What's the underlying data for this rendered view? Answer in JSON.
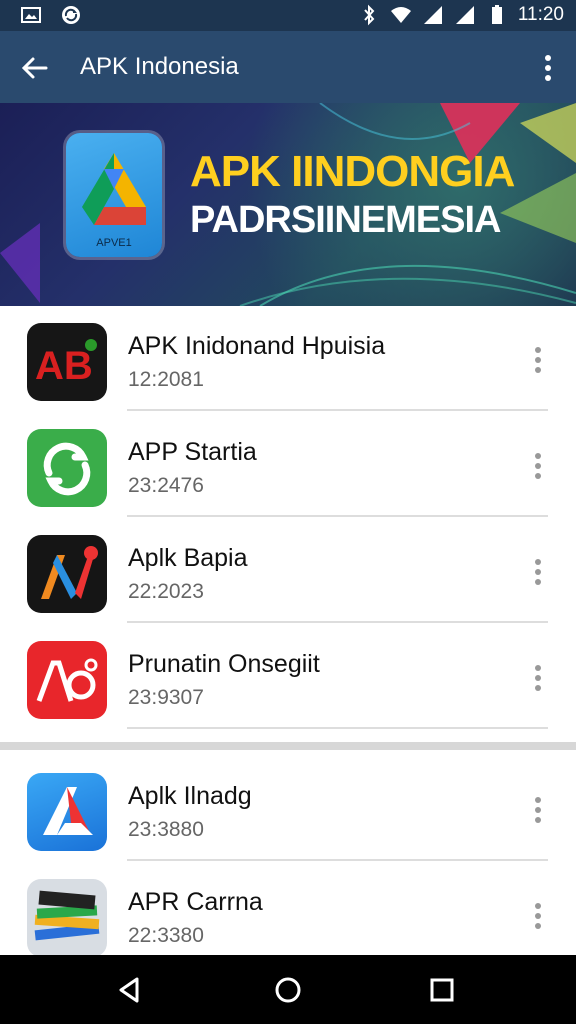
{
  "status_bar": {
    "time": "11:20"
  },
  "app_bar": {
    "title": "APK Indonesia"
  },
  "banner": {
    "line1": "APK IINDONGIA",
    "line2": "PADRSIINEMESIA",
    "icon_label": "APVE1"
  },
  "apps": [
    {
      "name": "APK Inidonand Hpuisia",
      "sub": "12:2081",
      "icon": "ab-red-icon"
    },
    {
      "name": "APP Startia",
      "sub": "23:2476",
      "icon": "green-refresh-icon"
    },
    {
      "name": "Aplk Bapia",
      "sub": "22:2023",
      "icon": "colorful-n-icon"
    },
    {
      "name": "Prunatin Onsegiit",
      "sub": "23:9307",
      "icon": "red-ao-icon"
    },
    {
      "name": "Aplk Ilnadg",
      "sub": "23:3880",
      "icon": "blue-a-icon"
    },
    {
      "name": "APR Carrna",
      "sub": "22:3380",
      "icon": "book-stack-icon"
    }
  ],
  "colors": {
    "app_bar": "#2a4a6e",
    "status_bar": "#1d3550",
    "banner_yellow": "#ffcf1f"
  }
}
